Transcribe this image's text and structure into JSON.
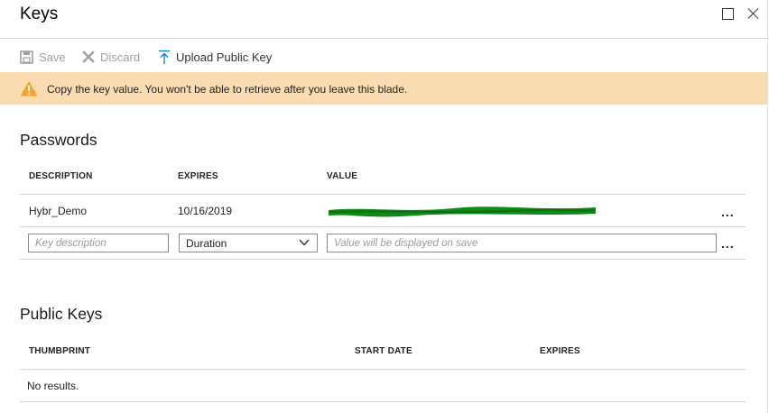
{
  "blade": {
    "title": "Keys"
  },
  "toolbar": {
    "save_label": "Save",
    "discard_label": "Discard",
    "upload_label": "Upload Public Key"
  },
  "warning": {
    "text": "Copy the key value. You won't be able to retrieve after you leave this blade.",
    "color": "#fbdcb2"
  },
  "passwords": {
    "heading": "Passwords",
    "columns": [
      "DESCRIPTION",
      "EXPIRES",
      "VALUE"
    ],
    "rows": [
      {
        "description": "Hybr_Demo",
        "expires": "10/16/2019"
      }
    ],
    "new_row": {
      "description_placeholder": "Key description",
      "duration_value": "Duration",
      "value_placeholder": "Value will be displayed on save"
    },
    "more_label": "..."
  },
  "public_keys": {
    "heading": "Public Keys",
    "columns": [
      "THUMBPRINT",
      "START DATE",
      "EXPIRES"
    ],
    "empty_text": "No results."
  },
  "colors": {
    "accent": "#0078d4",
    "warning_icon": "#f7a12b",
    "redaction": "#0f8a16"
  }
}
